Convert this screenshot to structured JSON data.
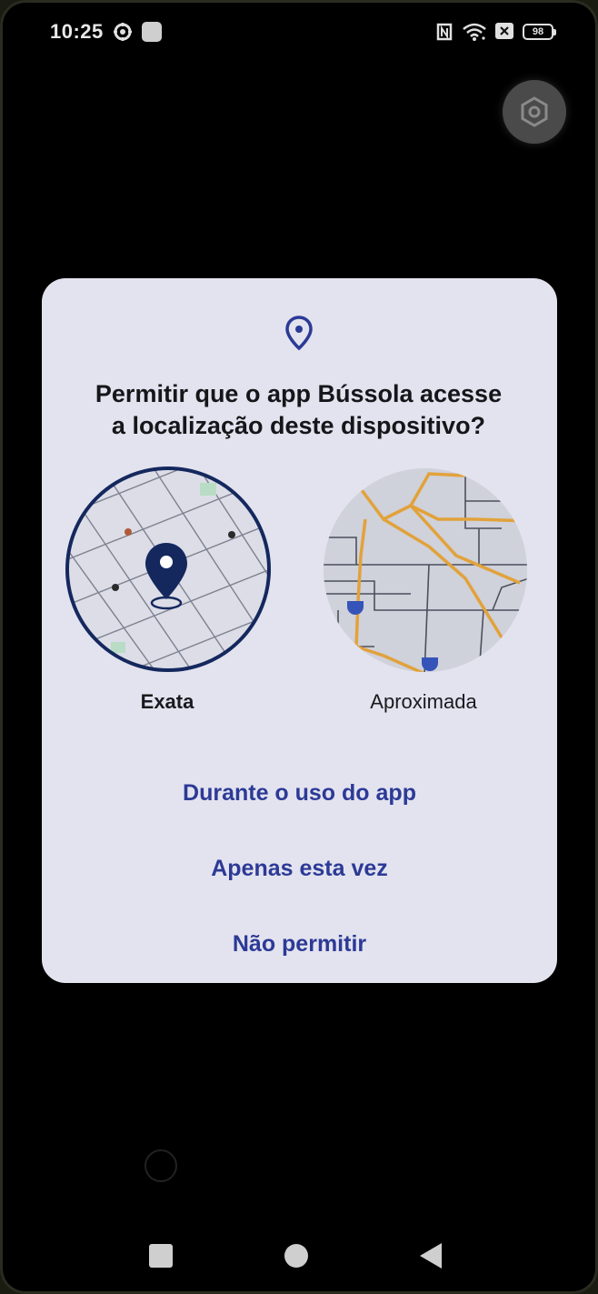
{
  "status_bar": {
    "time": "10:25",
    "battery": "98",
    "icons": [
      "gear-icon",
      "message-icon",
      "nfc-icon",
      "wifi-icon",
      "sim-off-icon",
      "battery-icon"
    ]
  },
  "floating_button": {
    "icon": "settings-hexagon-icon"
  },
  "dialog": {
    "icon": "location-pin-icon",
    "title_line1": "Permitir que o app Bússola acesse",
    "title_line2": "a localização deste dispositivo?",
    "options": {
      "exact_label": "Exata",
      "approx_label": "Aproximada",
      "selected": "exact"
    },
    "actions": {
      "while_using": "Durante o uso do app",
      "only_this_time": "Apenas esta vez",
      "deny": "Não permitir"
    }
  },
  "colors": {
    "dialog_bg": "#e3e3ef",
    "accent": "#2c3a96",
    "pin": "#14285e",
    "road": "#e2a23a"
  },
  "navbar": {
    "icons": [
      "recents-square-icon",
      "home-circle-icon",
      "back-triangle-icon"
    ]
  }
}
